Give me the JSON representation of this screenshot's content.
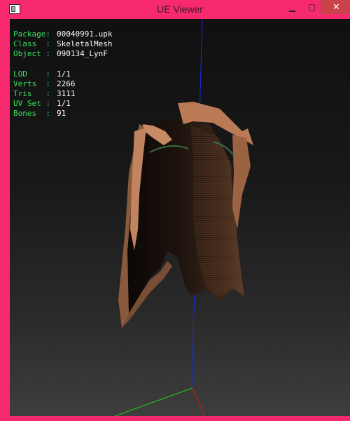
{
  "window": {
    "title": "UE Viewer",
    "minimize_glyph": "▁",
    "maximize_glyph": "▢",
    "close_glyph": "✕"
  },
  "info": {
    "package_key": "Package:",
    "package_value": "00040991.upk",
    "class_key": "Class  :",
    "class_value": "SkeletalMesh",
    "object_key": "Object :",
    "object_value": "090134_LynF",
    "lod_key": "LOD    :",
    "lod_value": "1/1",
    "verts_key": "Verts  :",
    "verts_value": "2266",
    "tris_key": "Tris   :",
    "tris_value": "3111",
    "uvset_key": "UV Set :",
    "uvset_value": "1/1",
    "bones_key": "Bones  :",
    "bones_value": "91"
  },
  "colors": {
    "window_frame": "#f72a6f",
    "close_button": "#c9424a",
    "info_key": "#37e05a",
    "info_value": "#ffffff",
    "axis_x": "#d01818",
    "axis_y": "#18d018",
    "axis_z": "#1a2be0",
    "mesh": "#b97a55"
  }
}
